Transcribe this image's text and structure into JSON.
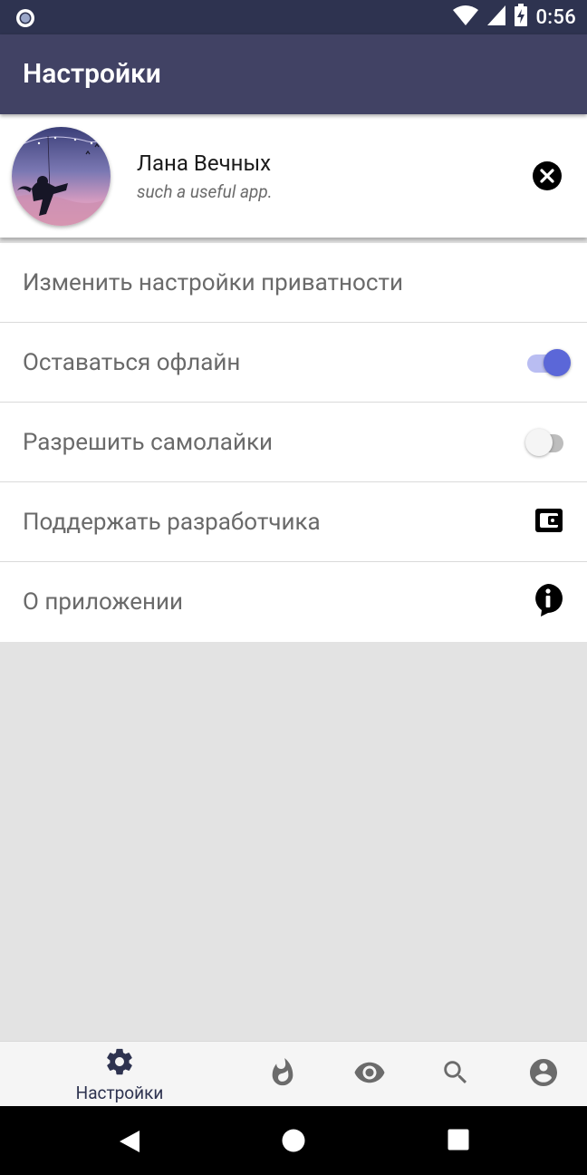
{
  "status_bar": {
    "time": "0:56",
    "icons": [
      "notification-circle-icon",
      "wifi-icon",
      "signal-icon",
      "battery-charging-icon"
    ]
  },
  "app_bar": {
    "title": "Настройки"
  },
  "profile": {
    "name": "Лана Вечных",
    "status": "such a useful app.",
    "avatar_icon": "avatar",
    "action_icon": "close-circle-icon"
  },
  "settings": {
    "items": [
      {
        "label": "Изменить настройки приватности",
        "control": "none"
      },
      {
        "label": "Оставаться офлайн",
        "control": "switch",
        "checked": true
      },
      {
        "label": "Разрешить самолайки",
        "control": "switch",
        "checked": false
      },
      {
        "label": "Поддержать разработчика",
        "control": "icon",
        "icon": "wallet-icon"
      },
      {
        "label": "О приложении",
        "control": "icon",
        "icon": "info-icon"
      }
    ]
  },
  "bottom_nav": {
    "active_label": "Настройки",
    "items": [
      "settings-icon",
      "flame-icon",
      "eye-icon",
      "search-icon",
      "account-icon"
    ]
  },
  "colors": {
    "status_bar": "#2e3350",
    "app_bar": "#414264",
    "accent": "#5b67d8",
    "background": "#e3e3e3"
  }
}
